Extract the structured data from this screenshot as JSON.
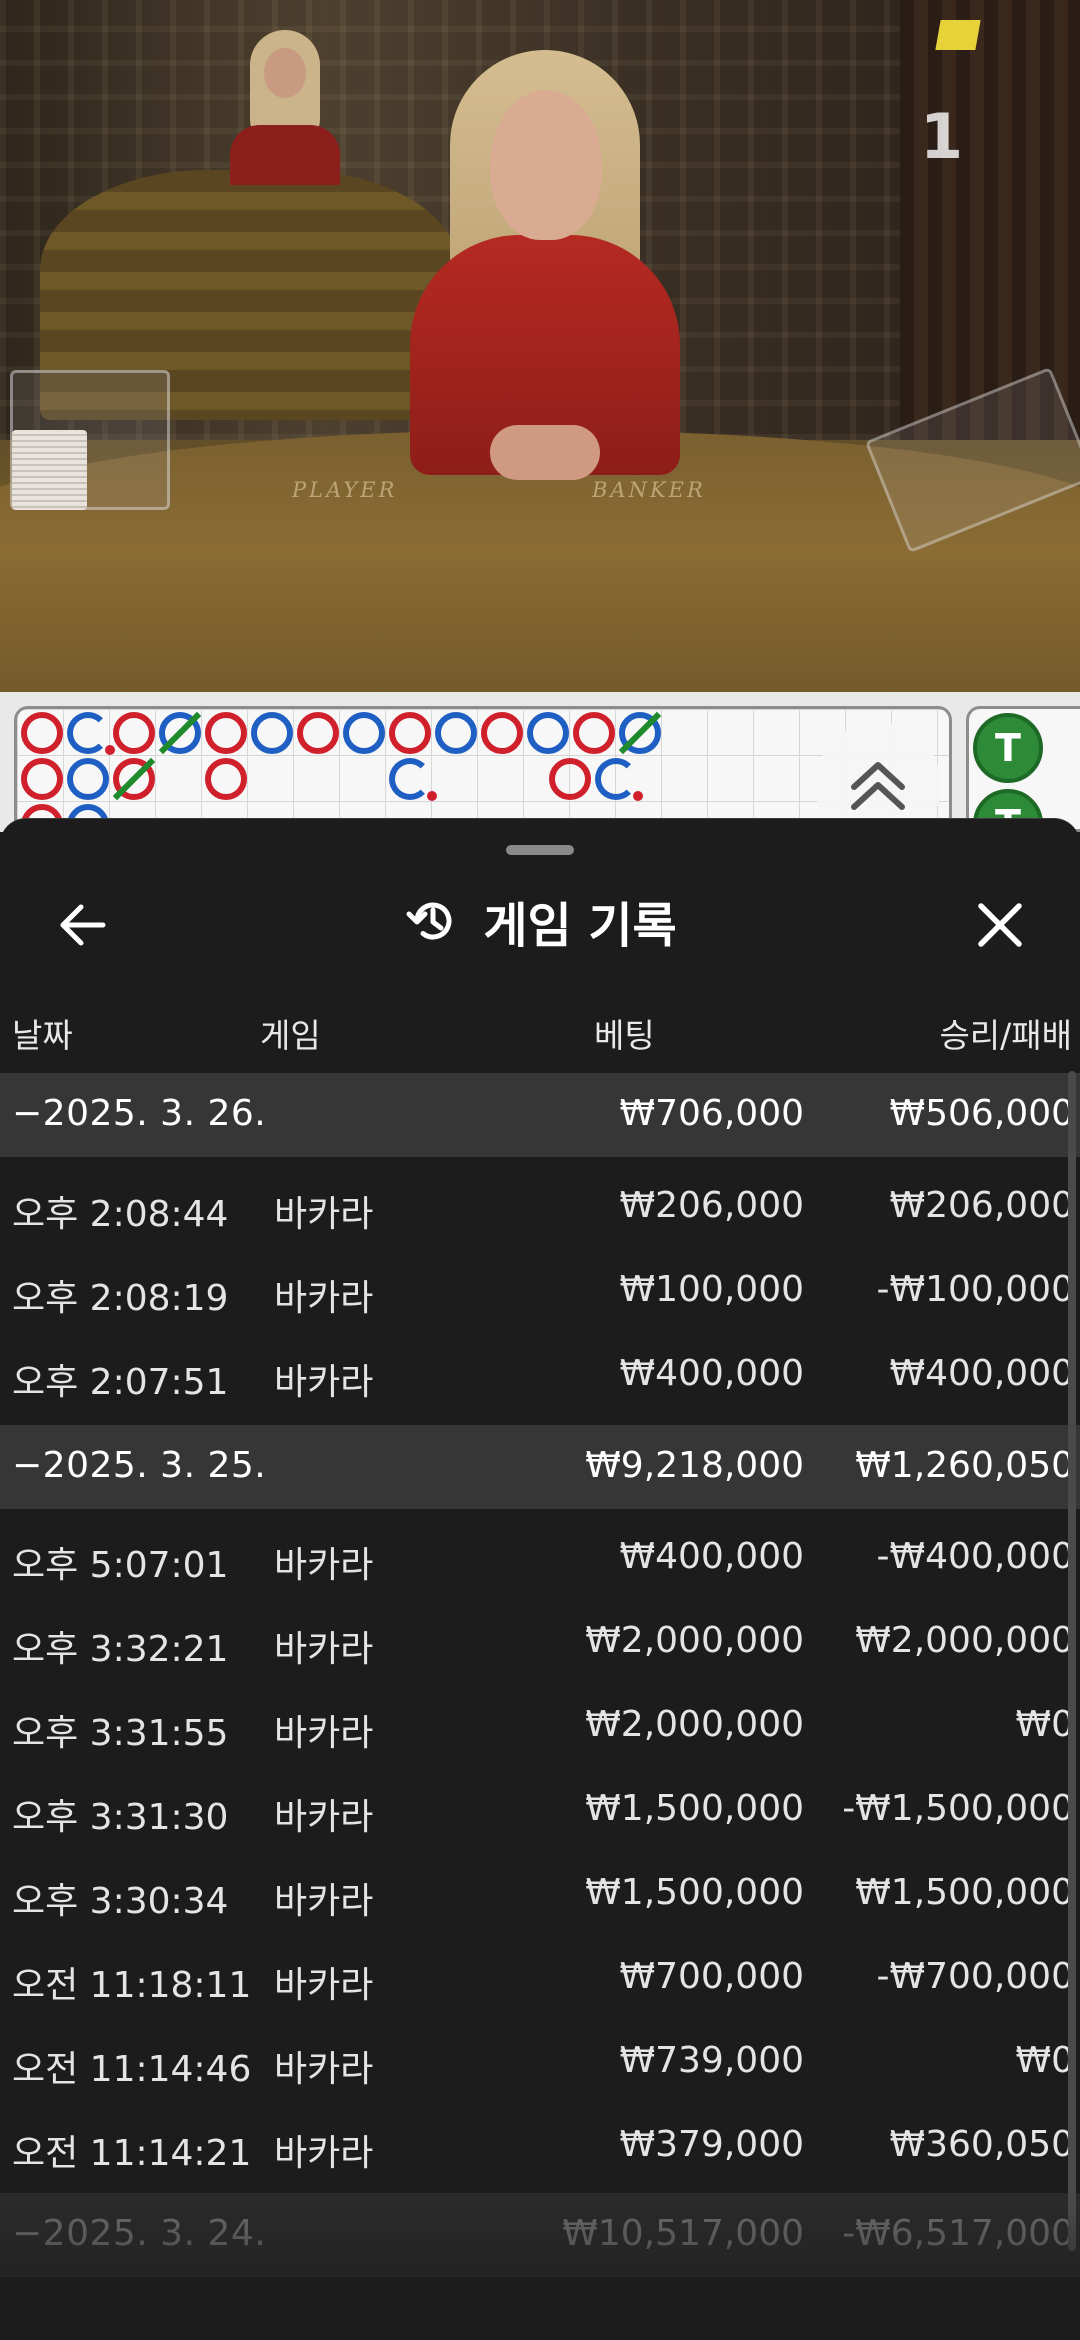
{
  "video": {
    "table_labels": {
      "player": "PLAYER",
      "banker": "BANKER"
    },
    "round_counter": "1"
  },
  "scoreboard": {
    "tie_label": "T"
  },
  "sheet": {
    "title": "게임 기록",
    "icons": {
      "back": "arrow-left-icon",
      "title": "history-icon",
      "close": "close-icon",
      "expand": "chevron-double-up-icon"
    },
    "columns": {
      "date": "날짜",
      "game": "게임",
      "bet": "베팅",
      "result": "승리/패배"
    },
    "groups": [
      {
        "date": "−2025. 3. 26.",
        "bet": "₩706,000",
        "result": "₩506,000",
        "rows": [
          {
            "time": "오후 2:08:44",
            "game": "바카라",
            "bet": "₩206,000",
            "result": "₩206,000"
          },
          {
            "time": "오후 2:08:19",
            "game": "바카라",
            "bet": "₩100,000",
            "result": "-₩100,000"
          },
          {
            "time": "오후 2:07:51",
            "game": "바카라",
            "bet": "₩400,000",
            "result": "₩400,000"
          }
        ]
      },
      {
        "date": "−2025. 3. 25.",
        "bet": "₩9,218,000",
        "result": "₩1,260,050",
        "rows": [
          {
            "time": "오후 5:07:01",
            "game": "바카라",
            "bet": "₩400,000",
            "result": "-₩400,000"
          },
          {
            "time": "오후 3:32:21",
            "game": "바카라",
            "bet": "₩2,000,000",
            "result": "₩2,000,000"
          },
          {
            "time": "오후 3:31:55",
            "game": "바카라",
            "bet": "₩2,000,000",
            "result": "₩0"
          },
          {
            "time": "오후 3:31:30",
            "game": "바카라",
            "bet": "₩1,500,000",
            "result": "-₩1,500,000"
          },
          {
            "time": "오후 3:30:34",
            "game": "바카라",
            "bet": "₩1,500,000",
            "result": "₩1,500,000"
          },
          {
            "time": "오전 11:18:11",
            "game": "바카라",
            "bet": "₩700,000",
            "result": "-₩700,000"
          },
          {
            "time": "오전 11:14:46",
            "game": "바카라",
            "bet": "₩739,000",
            "result": "₩0"
          },
          {
            "time": "오전 11:14:21",
            "game": "바카라",
            "bet": "₩379,000",
            "result": "₩360,050"
          }
        ]
      },
      {
        "date": "−2025. 3. 24.",
        "bet": "₩10,517,000",
        "result": "-₩6,517,000",
        "rows": []
      }
    ]
  }
}
